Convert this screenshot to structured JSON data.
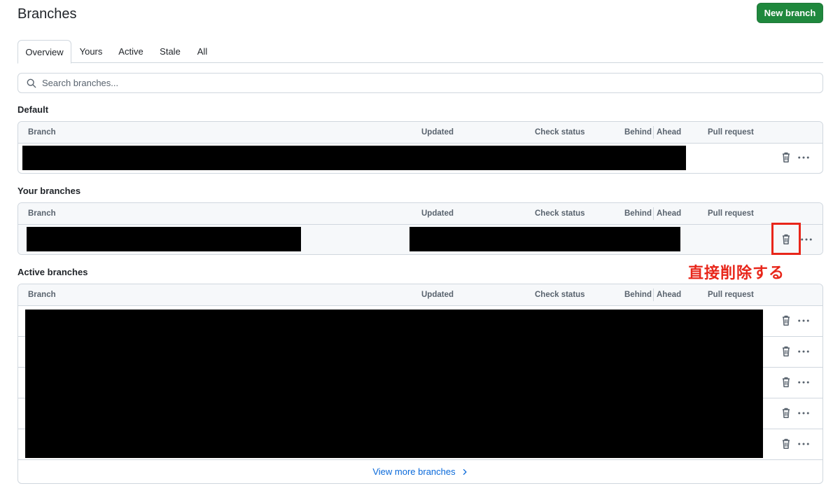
{
  "header": {
    "title": "Branches",
    "new_branch_label": "New branch"
  },
  "tabs": [
    {
      "label": "Overview",
      "selected": true
    },
    {
      "label": "Yours",
      "selected": false
    },
    {
      "label": "Active",
      "selected": false
    },
    {
      "label": "Stale",
      "selected": false
    },
    {
      "label": "All",
      "selected": false
    }
  ],
  "search": {
    "placeholder": "Search branches...",
    "value": ""
  },
  "columns": {
    "branch": "Branch",
    "updated": "Updated",
    "check_status": "Check status",
    "behind": "Behind",
    "ahead": "Ahead",
    "pull_request": "Pull request"
  },
  "sections": {
    "default": {
      "title": "Default"
    },
    "yours": {
      "title": "Your branches"
    },
    "active": {
      "title": "Active branches",
      "view_more_label": "View more branches"
    }
  },
  "annotation": {
    "text": "直接削除する",
    "color": "#e8261a"
  },
  "icons": {
    "search": "search-icon",
    "delete": "trash-icon",
    "more": "kebab-horizontal-icon",
    "chevron": "chevron-right-icon"
  },
  "colors": {
    "primary_button": "#1f883d",
    "link": "#0969da",
    "border": "#d0d7de",
    "header_bg": "#f6f8fa",
    "annotation": "#e8261a"
  }
}
